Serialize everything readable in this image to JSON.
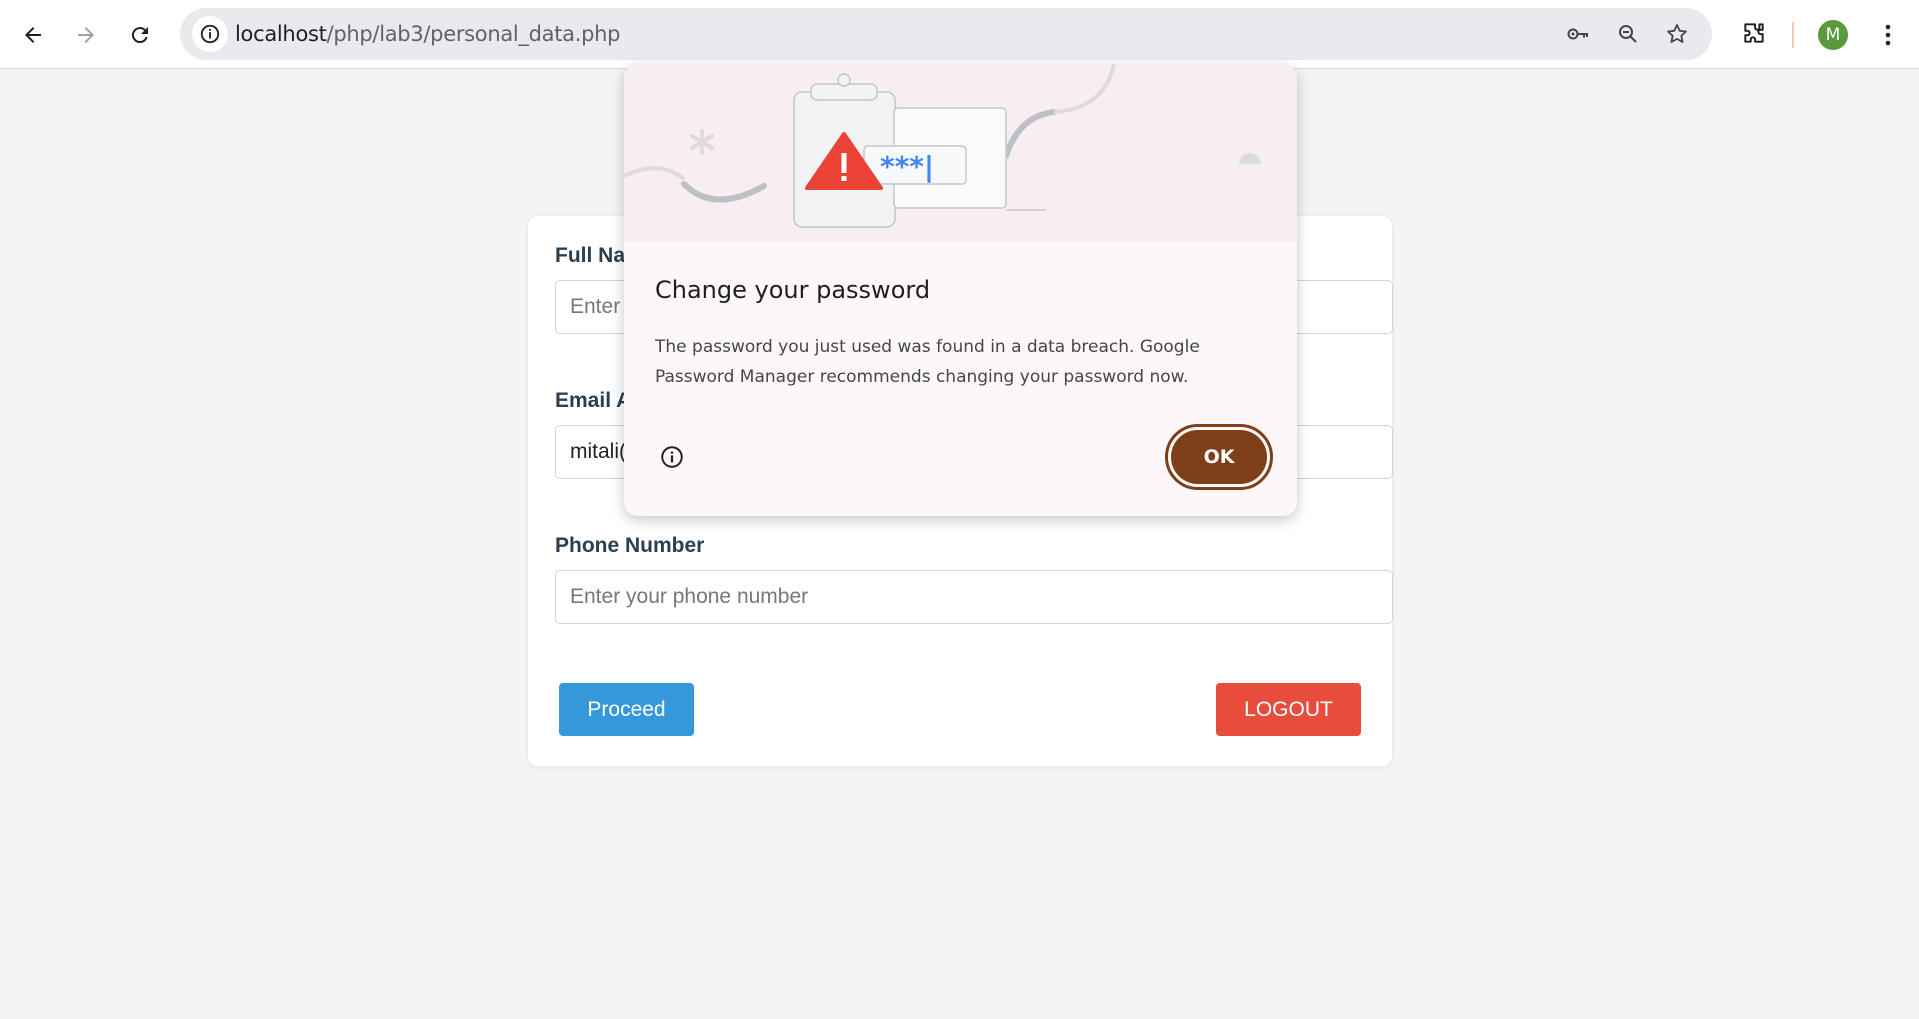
{
  "browser": {
    "url_host": "localhost",
    "url_path": "/php/lab3/personal_data.php",
    "avatar_letter": "M",
    "avatar_color": "#5b9a3c"
  },
  "form": {
    "full_name_label": "Full Na",
    "full_name_placeholder": "Enter",
    "email_label": "Email A",
    "email_value": "mitali(",
    "phone_label": "Phone Number",
    "phone_placeholder": "Enter your phone number",
    "proceed_label": "Proceed",
    "logout_label": "LOGOUT",
    "proceed_color": "#3498db",
    "logout_color": "#e74c3c"
  },
  "dialog": {
    "title": "Change your password",
    "body": "The password you just used was found in a data breach. Google Password Manager recommends changing your password now.",
    "ok_label": "OK",
    "ok_color": "#7e3f18",
    "illustration_text": "***|"
  }
}
